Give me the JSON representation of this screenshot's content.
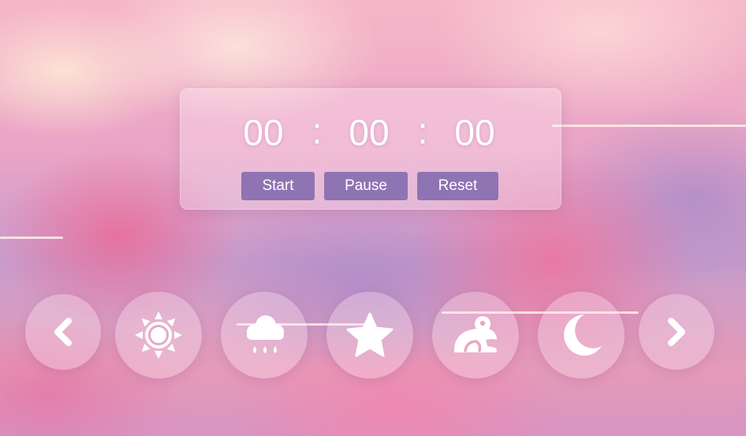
{
  "timer": {
    "hours": "00",
    "minutes": "00",
    "seconds": "00",
    "separator": ":"
  },
  "controls": {
    "start_label": "Start",
    "pause_label": "Pause",
    "reset_label": "Reset"
  },
  "theme_bar": {
    "items": [
      {
        "icon": "chevron-left-icon"
      },
      {
        "icon": "sun-icon"
      },
      {
        "icon": "rain-cloud-icon"
      },
      {
        "icon": "star-icon"
      },
      {
        "icon": "frog-icon"
      },
      {
        "icon": "moon-icon"
      },
      {
        "icon": "chevron-right-icon"
      }
    ]
  },
  "colors": {
    "button": "#8e74b3",
    "icon": "#ffffff",
    "card": "rgba(255,240,248,0.32)"
  }
}
